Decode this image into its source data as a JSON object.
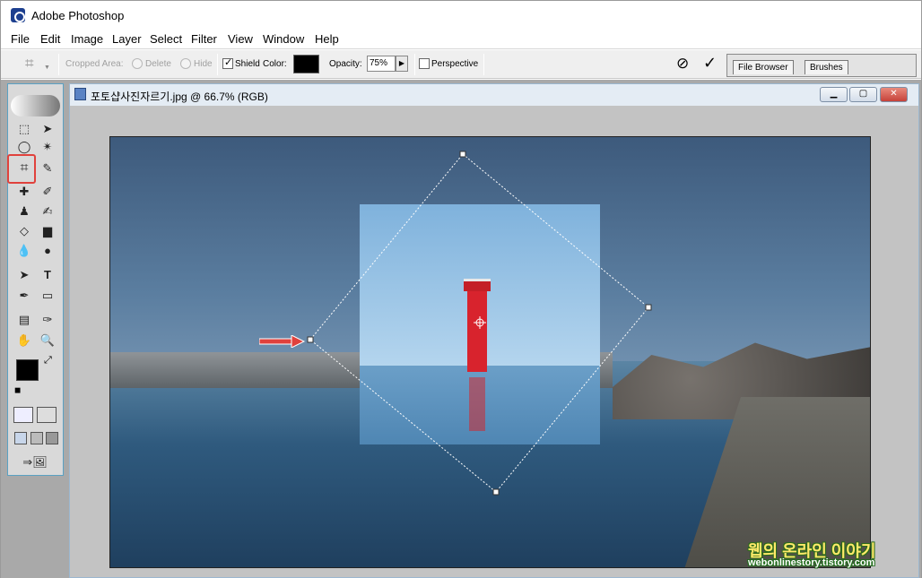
{
  "app": {
    "title": "Adobe Photoshop"
  },
  "menu": [
    "File",
    "Edit",
    "Image",
    "Layer",
    "Select",
    "Filter",
    "View",
    "Window",
    "Help"
  ],
  "options": {
    "cropped_area_label": "Cropped Area:",
    "delete_label": "Delete",
    "hide_label": "Hide",
    "shield_label": "Shield",
    "color_label": "Color:",
    "shield_color": "#000000",
    "opacity_label": "Opacity:",
    "opacity_value": "75%",
    "perspective_label": "Perspective"
  },
  "palette_well": {
    "tabs": [
      "File Browser",
      "Brushes"
    ]
  },
  "document": {
    "title": "포토샵사진자르기.jpg @ 66.7% (RGB)"
  },
  "watermark": {
    "korean": "웹의 온라인 이야기",
    "url": "webonlinestory.tistory.com"
  },
  "colors": {
    "crop_highlight": "#e0413c",
    "arrow": "#e0413c",
    "lighthouse": "#d8232d"
  },
  "icons": [
    "crop-tool-icon",
    "marquee-icon",
    "move-icon",
    "lasso-icon",
    "magic-wand-icon",
    "slice-icon",
    "healing-icon",
    "brush-icon",
    "stamp-icon",
    "history-brush-icon",
    "eraser-icon",
    "gradient-icon",
    "blur-icon",
    "dodge-icon",
    "path-select-icon",
    "type-icon",
    "pen-icon",
    "shape-icon",
    "notes-icon",
    "eyedropper-icon",
    "hand-icon",
    "zoom-icon",
    "cancel-icon",
    "commit-icon"
  ]
}
